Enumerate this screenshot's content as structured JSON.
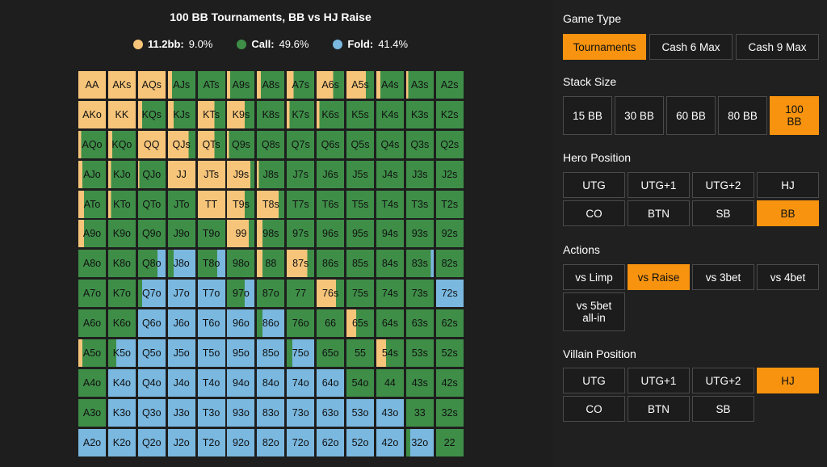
{
  "chart": {
    "title": "100 BB Tournaments, BB vs HJ Raise",
    "legend": [
      {
        "name": "11.2bb:",
        "value": "9.0%",
        "color": "#f7c57a"
      },
      {
        "name": "Call:",
        "value": "49.6%",
        "color": "#3e8e48"
      },
      {
        "name": "Fold:",
        "value": "41.4%",
        "color": "#7ab8e0"
      }
    ]
  },
  "colors": {
    "raise": "#f7c57a",
    "call": "#3e8e48",
    "fold": "#7ab8e0",
    "accent": "#f7930f"
  },
  "chart_data": {
    "type": "heatmap",
    "title": "100 BB Tournaments, BB vs HJ Raise",
    "legend_placement": "top",
    "totals": {
      "raise": 9.0,
      "call": 49.6,
      "fold": 41.4
    },
    "rows": [
      [
        {
          "l": "AA",
          "r": 1,
          "c": 0,
          "f": 0
        },
        {
          "l": "AKs",
          "r": 1,
          "c": 0,
          "f": 0
        },
        {
          "l": "AQs",
          "r": 1,
          "c": 0,
          "f": 0
        },
        {
          "l": "AJs",
          "r": 0.15,
          "c": 0.85,
          "f": 0
        },
        {
          "l": "ATs",
          "r": 0,
          "c": 1,
          "f": 0
        },
        {
          "l": "A9s",
          "r": 0.12,
          "c": 0.88,
          "f": 0
        },
        {
          "l": "A8s",
          "r": 0.15,
          "c": 0.85,
          "f": 0
        },
        {
          "l": "A7s",
          "r": 0.25,
          "c": 0.75,
          "f": 0
        },
        {
          "l": "A6s",
          "r": 0.6,
          "c": 0.4,
          "f": 0
        },
        {
          "l": "A5s",
          "r": 0.7,
          "c": 0.3,
          "f": 0
        },
        {
          "l": "A4s",
          "r": 0.15,
          "c": 0.85,
          "f": 0
        },
        {
          "l": "A3s",
          "r": 0.08,
          "c": 0.92,
          "f": 0
        },
        {
          "l": "A2s",
          "r": 0,
          "c": 1,
          "f": 0
        }
      ],
      [
        {
          "l": "AKo",
          "r": 1,
          "c": 0,
          "f": 0
        },
        {
          "l": "KK",
          "r": 1,
          "c": 0,
          "f": 0
        },
        {
          "l": "KQs",
          "r": 0.15,
          "c": 0.85,
          "f": 0
        },
        {
          "l": "KJs",
          "r": 0.2,
          "c": 0.8,
          "f": 0
        },
        {
          "l": "KTs",
          "r": 0.6,
          "c": 0.4,
          "f": 0
        },
        {
          "l": "K9s",
          "r": 0.65,
          "c": 0.35,
          "f": 0
        },
        {
          "l": "K8s",
          "r": 0,
          "c": 1,
          "f": 0
        },
        {
          "l": "K7s",
          "r": 0.1,
          "c": 0.9,
          "f": 0
        },
        {
          "l": "K6s",
          "r": 0.1,
          "c": 0.9,
          "f": 0
        },
        {
          "l": "K5s",
          "r": 0,
          "c": 1,
          "f": 0
        },
        {
          "l": "K4s",
          "r": 0,
          "c": 1,
          "f": 0
        },
        {
          "l": "K3s",
          "r": 0,
          "c": 1,
          "f": 0
        },
        {
          "l": "K2s",
          "r": 0,
          "c": 1,
          "f": 0
        }
      ],
      [
        {
          "l": "AQo",
          "r": 0.1,
          "c": 0.9,
          "f": 0
        },
        {
          "l": "KQo",
          "r": 0.15,
          "c": 0.85,
          "f": 0
        },
        {
          "l": "QQ",
          "r": 1,
          "c": 0,
          "f": 0
        },
        {
          "l": "QJs",
          "r": 0.75,
          "c": 0.25,
          "f": 0
        },
        {
          "l": "QTs",
          "r": 0.6,
          "c": 0.4,
          "f": 0
        },
        {
          "l": "Q9s",
          "r": 0.08,
          "c": 0.92,
          "f": 0
        },
        {
          "l": "Q8s",
          "r": 0,
          "c": 1,
          "f": 0
        },
        {
          "l": "Q7s",
          "r": 0,
          "c": 1,
          "f": 0
        },
        {
          "l": "Q6s",
          "r": 0,
          "c": 1,
          "f": 0
        },
        {
          "l": "Q5s",
          "r": 0,
          "c": 1,
          "f": 0
        },
        {
          "l": "Q4s",
          "r": 0,
          "c": 1,
          "f": 0
        },
        {
          "l": "Q3s",
          "r": 0,
          "c": 1,
          "f": 0
        },
        {
          "l": "Q2s",
          "r": 0,
          "c": 1,
          "f": 0
        }
      ],
      [
        {
          "l": "AJo",
          "r": 0.15,
          "c": 0.85,
          "f": 0
        },
        {
          "l": "KJo",
          "r": 0.1,
          "c": 0.9,
          "f": 0
        },
        {
          "l": "QJo",
          "r": 0.05,
          "c": 0.95,
          "f": 0
        },
        {
          "l": "JJ",
          "r": 1,
          "c": 0,
          "f": 0
        },
        {
          "l": "JTs",
          "r": 1,
          "c": 0,
          "f": 0
        },
        {
          "l": "J9s",
          "r": 0.85,
          "c": 0.15,
          "f": 0
        },
        {
          "l": "J8s",
          "r": 0.08,
          "c": 0.92,
          "f": 0
        },
        {
          "l": "J7s",
          "r": 0,
          "c": 1,
          "f": 0
        },
        {
          "l": "J6s",
          "r": 0,
          "c": 1,
          "f": 0
        },
        {
          "l": "J5s",
          "r": 0,
          "c": 1,
          "f": 0
        },
        {
          "l": "J4s",
          "r": 0,
          "c": 1,
          "f": 0
        },
        {
          "l": "J3s",
          "r": 0,
          "c": 1,
          "f": 0
        },
        {
          "l": "J2s",
          "r": 0,
          "c": 1,
          "f": 0
        }
      ],
      [
        {
          "l": "ATo",
          "r": 0.2,
          "c": 0.8,
          "f": 0
        },
        {
          "l": "KTo",
          "r": 0.1,
          "c": 0.9,
          "f": 0
        },
        {
          "l": "QTo",
          "r": 0,
          "c": 1,
          "f": 0
        },
        {
          "l": "JTo",
          "r": 0,
          "c": 1,
          "f": 0
        },
        {
          "l": "TT",
          "r": 1,
          "c": 0,
          "f": 0
        },
        {
          "l": "T9s",
          "r": 0.65,
          "c": 0.35,
          "f": 0
        },
        {
          "l": "T8s",
          "r": 0.8,
          "c": 0.2,
          "f": 0
        },
        {
          "l": "T7s",
          "r": 0,
          "c": 1,
          "f": 0
        },
        {
          "l": "T6s",
          "r": 0,
          "c": 1,
          "f": 0
        },
        {
          "l": "T5s",
          "r": 0,
          "c": 1,
          "f": 0
        },
        {
          "l": "T4s",
          "r": 0,
          "c": 1,
          "f": 0
        },
        {
          "l": "T3s",
          "r": 0,
          "c": 1,
          "f": 0
        },
        {
          "l": "T2s",
          "r": 0,
          "c": 1,
          "f": 0
        }
      ],
      [
        {
          "l": "A9o",
          "r": 0.2,
          "c": 0.8,
          "f": 0
        },
        {
          "l": "K9o",
          "r": 0,
          "c": 1,
          "f": 0
        },
        {
          "l": "Q9o",
          "r": 0,
          "c": 1,
          "f": 0
        },
        {
          "l": "J9o",
          "r": 0,
          "c": 1,
          "f": 0
        },
        {
          "l": "T9o",
          "r": 0,
          "c": 1,
          "f": 0
        },
        {
          "l": "99",
          "r": 0.8,
          "c": 0.2,
          "f": 0
        },
        {
          "l": "98s",
          "r": 0.2,
          "c": 0.8,
          "f": 0
        },
        {
          "l": "97s",
          "r": 0,
          "c": 1,
          "f": 0
        },
        {
          "l": "96s",
          "r": 0,
          "c": 1,
          "f": 0
        },
        {
          "l": "95s",
          "r": 0,
          "c": 1,
          "f": 0
        },
        {
          "l": "94s",
          "r": 0,
          "c": 1,
          "f": 0
        },
        {
          "l": "93s",
          "r": 0,
          "c": 1,
          "f": 0
        },
        {
          "l": "92s",
          "r": 0,
          "c": 1,
          "f": 0
        }
      ],
      [
        {
          "l": "A8o",
          "r": 0,
          "c": 1,
          "f": 0
        },
        {
          "l": "K8o",
          "r": 0,
          "c": 1,
          "f": 0
        },
        {
          "l": "Q8o",
          "r": 0,
          "c": 0.7,
          "f": 0.3
        },
        {
          "l": "J8o",
          "r": 0,
          "c": 0.2,
          "f": 0.8
        },
        {
          "l": "T8o",
          "r": 0,
          "c": 0.7,
          "f": 0.3
        },
        {
          "l": "98o",
          "r": 0,
          "c": 1,
          "f": 0
        },
        {
          "l": "88",
          "r": 0.2,
          "c": 0.8,
          "f": 0
        },
        {
          "l": "87s",
          "r": 0.75,
          "c": 0.25,
          "f": 0
        },
        {
          "l": "86s",
          "r": 0,
          "c": 1,
          "f": 0
        },
        {
          "l": "85s",
          "r": 0,
          "c": 1,
          "f": 0
        },
        {
          "l": "84s",
          "r": 0,
          "c": 1,
          "f": 0
        },
        {
          "l": "83s",
          "r": 0,
          "c": 0.9,
          "f": 0.1
        },
        {
          "l": "82s",
          "r": 0,
          "c": 1,
          "f": 0
        }
      ],
      [
        {
          "l": "A7o",
          "r": 0,
          "c": 1,
          "f": 0
        },
        {
          "l": "K7o",
          "r": 0,
          "c": 1,
          "f": 0
        },
        {
          "l": "Q7o",
          "r": 0,
          "c": 0.15,
          "f": 0.85
        },
        {
          "l": "J7o",
          "r": 0,
          "c": 0,
          "f": 1
        },
        {
          "l": "T7o",
          "r": 0,
          "c": 0,
          "f": 1
        },
        {
          "l": "97o",
          "r": 0,
          "c": 0.65,
          "f": 0.35
        },
        {
          "l": "87o",
          "r": 0,
          "c": 1,
          "f": 0
        },
        {
          "l": "77",
          "r": 0,
          "c": 1,
          "f": 0
        },
        {
          "l": "76s",
          "r": 0.7,
          "c": 0.3,
          "f": 0
        },
        {
          "l": "75s",
          "r": 0,
          "c": 1,
          "f": 0
        },
        {
          "l": "74s",
          "r": 0,
          "c": 1,
          "f": 0
        },
        {
          "l": "73s",
          "r": 0,
          "c": 1,
          "f": 0
        },
        {
          "l": "72s",
          "r": 0,
          "c": 0,
          "f": 1
        }
      ],
      [
        {
          "l": "A6o",
          "r": 0,
          "c": 1,
          "f": 0
        },
        {
          "l": "K6o",
          "r": 0,
          "c": 1,
          "f": 0
        },
        {
          "l": "Q6o",
          "r": 0,
          "c": 0,
          "f": 1
        },
        {
          "l": "J6o",
          "r": 0,
          "c": 0,
          "f": 1
        },
        {
          "l": "T6o",
          "r": 0,
          "c": 0,
          "f": 1
        },
        {
          "l": "96o",
          "r": 0,
          "c": 0,
          "f": 1
        },
        {
          "l": "86o",
          "r": 0,
          "c": 0.2,
          "f": 0.8
        },
        {
          "l": "76o",
          "r": 0,
          "c": 1,
          "f": 0
        },
        {
          "l": "66",
          "r": 0,
          "c": 1,
          "f": 0
        },
        {
          "l": "65s",
          "r": 0.35,
          "c": 0.65,
          "f": 0
        },
        {
          "l": "64s",
          "r": 0,
          "c": 1,
          "f": 0
        },
        {
          "l": "63s",
          "r": 0,
          "c": 1,
          "f": 0
        },
        {
          "l": "62s",
          "r": 0,
          "c": 1,
          "f": 0
        }
      ],
      [
        {
          "l": "A5o",
          "r": 0.15,
          "c": 0.85,
          "f": 0
        },
        {
          "l": "K5o",
          "r": 0,
          "c": 0.3,
          "f": 0.7
        },
        {
          "l": "Q5o",
          "r": 0,
          "c": 0,
          "f": 1
        },
        {
          "l": "J5o",
          "r": 0,
          "c": 0,
          "f": 1
        },
        {
          "l": "T5o",
          "r": 0,
          "c": 0,
          "f": 1
        },
        {
          "l": "95o",
          "r": 0,
          "c": 0,
          "f": 1
        },
        {
          "l": "85o",
          "r": 0,
          "c": 0,
          "f": 1
        },
        {
          "l": "75o",
          "r": 0,
          "c": 0.2,
          "f": 0.8
        },
        {
          "l": "65o",
          "r": 0,
          "c": 1,
          "f": 0
        },
        {
          "l": "55",
          "r": 0,
          "c": 1,
          "f": 0
        },
        {
          "l": "54s",
          "r": 0.35,
          "c": 0.65,
          "f": 0
        },
        {
          "l": "53s",
          "r": 0,
          "c": 1,
          "f": 0
        },
        {
          "l": "52s",
          "r": 0,
          "c": 1,
          "f": 0
        }
      ],
      [
        {
          "l": "A4o",
          "r": 0,
          "c": 1,
          "f": 0
        },
        {
          "l": "K4o",
          "r": 0,
          "c": 0,
          "f": 1
        },
        {
          "l": "Q4o",
          "r": 0,
          "c": 0,
          "f": 1
        },
        {
          "l": "J4o",
          "r": 0,
          "c": 0,
          "f": 1
        },
        {
          "l": "T4o",
          "r": 0,
          "c": 0,
          "f": 1
        },
        {
          "l": "94o",
          "r": 0,
          "c": 0,
          "f": 1
        },
        {
          "l": "84o",
          "r": 0,
          "c": 0,
          "f": 1
        },
        {
          "l": "74o",
          "r": 0,
          "c": 0,
          "f": 1
        },
        {
          "l": "64o",
          "r": 0,
          "c": 0,
          "f": 1
        },
        {
          "l": "54o",
          "r": 0,
          "c": 1,
          "f": 0
        },
        {
          "l": "44",
          "r": 0,
          "c": 1,
          "f": 0
        },
        {
          "l": "43s",
          "r": 0,
          "c": 1,
          "f": 0
        },
        {
          "l": "42s",
          "r": 0,
          "c": 1,
          "f": 0
        }
      ],
      [
        {
          "l": "A3o",
          "r": 0,
          "c": 1,
          "f": 0
        },
        {
          "l": "K3o",
          "r": 0,
          "c": 0,
          "f": 1
        },
        {
          "l": "Q3o",
          "r": 0,
          "c": 0,
          "f": 1
        },
        {
          "l": "J3o",
          "r": 0,
          "c": 0,
          "f": 1
        },
        {
          "l": "T3o",
          "r": 0,
          "c": 0,
          "f": 1
        },
        {
          "l": "93o",
          "r": 0,
          "c": 0,
          "f": 1
        },
        {
          "l": "83o",
          "r": 0,
          "c": 0,
          "f": 1
        },
        {
          "l": "73o",
          "r": 0,
          "c": 0,
          "f": 1
        },
        {
          "l": "63o",
          "r": 0,
          "c": 0,
          "f": 1
        },
        {
          "l": "53o",
          "r": 0,
          "c": 0,
          "f": 1
        },
        {
          "l": "43o",
          "r": 0,
          "c": 0,
          "f": 1
        },
        {
          "l": "33",
          "r": 0,
          "c": 1,
          "f": 0
        },
        {
          "l": "32s",
          "r": 0,
          "c": 1,
          "f": 0
        }
      ],
      [
        {
          "l": "A2o",
          "r": 0,
          "c": 0,
          "f": 1
        },
        {
          "l": "K2o",
          "r": 0,
          "c": 0,
          "f": 1
        },
        {
          "l": "Q2o",
          "r": 0,
          "c": 0,
          "f": 1
        },
        {
          "l": "J2o",
          "r": 0,
          "c": 0,
          "f": 1
        },
        {
          "l": "T2o",
          "r": 0,
          "c": 0,
          "f": 1
        },
        {
          "l": "92o",
          "r": 0,
          "c": 0,
          "f": 1
        },
        {
          "l": "82o",
          "r": 0,
          "c": 0,
          "f": 1
        },
        {
          "l": "72o",
          "r": 0,
          "c": 0,
          "f": 1
        },
        {
          "l": "62o",
          "r": 0,
          "c": 0,
          "f": 1
        },
        {
          "l": "52o",
          "r": 0,
          "c": 0,
          "f": 1
        },
        {
          "l": "42o",
          "r": 0,
          "c": 0,
          "f": 1
        },
        {
          "l": "32o",
          "r": 0,
          "c": 0.15,
          "f": 0.85
        },
        {
          "l": "22",
          "r": 0,
          "c": 1,
          "f": 0
        }
      ]
    ]
  },
  "panel": {
    "game_type": {
      "title": "Game Type",
      "buttons": [
        {
          "label": "Tournaments",
          "active": true
        },
        {
          "label": "Cash 6 Max",
          "active": false
        },
        {
          "label": "Cash 9 Max",
          "active": false
        }
      ]
    },
    "stack_size": {
      "title": "Stack Size",
      "buttons": [
        {
          "label": "15 BB",
          "active": false
        },
        {
          "label": "30 BB",
          "active": false
        },
        {
          "label": "60 BB",
          "active": false
        },
        {
          "label": "80 BB",
          "active": false
        },
        {
          "label": "100 BB",
          "active": true
        }
      ]
    },
    "hero_position": {
      "title": "Hero Position",
      "buttons": [
        {
          "label": "UTG",
          "active": false
        },
        {
          "label": "UTG+1",
          "active": false
        },
        {
          "label": "UTG+2",
          "active": false
        },
        {
          "label": "HJ",
          "active": false
        },
        {
          "label": "CO",
          "active": false
        },
        {
          "label": "BTN",
          "active": false
        },
        {
          "label": "SB",
          "active": false
        },
        {
          "label": "BB",
          "active": true
        }
      ]
    },
    "actions": {
      "title": "Actions",
      "buttons": [
        {
          "label": "vs Limp",
          "active": false
        },
        {
          "label": "vs Raise",
          "active": true
        },
        {
          "label": "vs 3bet",
          "active": false
        },
        {
          "label": "vs 4bet",
          "active": false
        },
        {
          "label": "vs 5bet all-in",
          "active": false
        }
      ]
    },
    "villain_position": {
      "title": "Villain Position",
      "buttons": [
        {
          "label": "UTG",
          "active": false
        },
        {
          "label": "UTG+1",
          "active": false
        },
        {
          "label": "UTG+2",
          "active": false
        },
        {
          "label": "HJ",
          "active": true
        },
        {
          "label": "CO",
          "active": false
        },
        {
          "label": "BTN",
          "active": false
        },
        {
          "label": "SB",
          "active": false
        }
      ]
    }
  }
}
